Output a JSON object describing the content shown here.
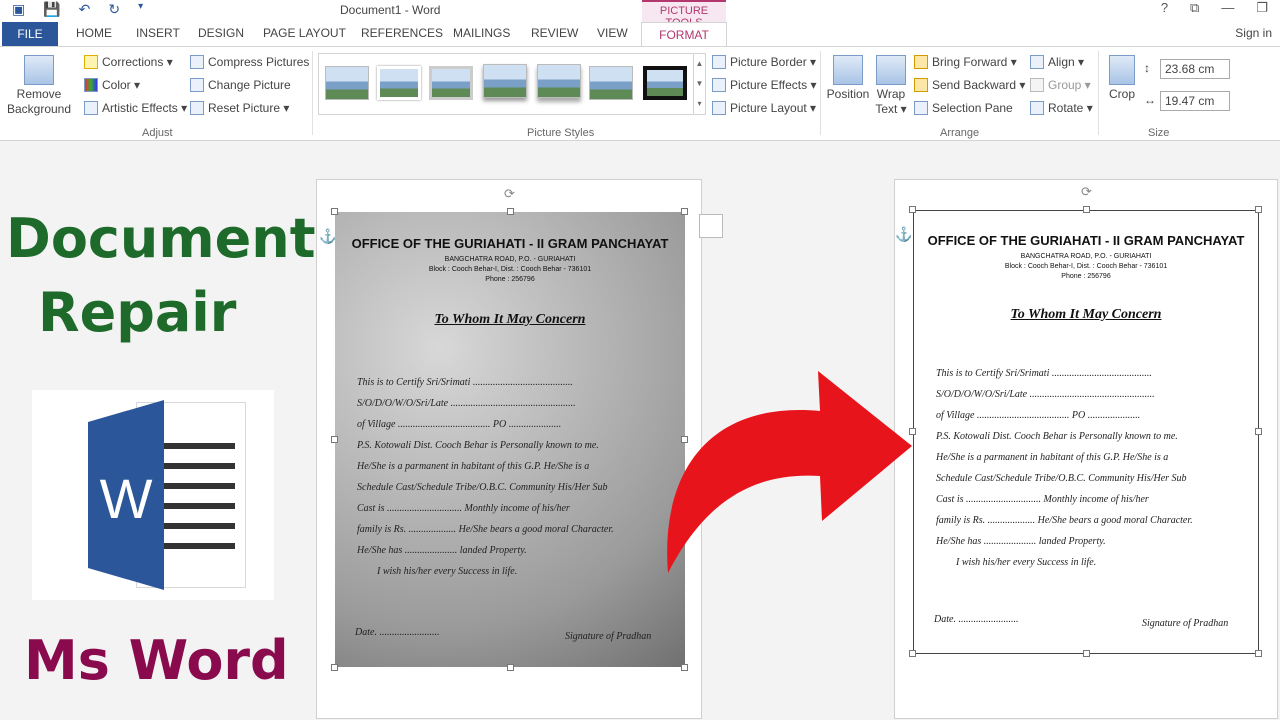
{
  "window": {
    "title": "Document1 - Word",
    "context_title": "PICTURE TOOLS",
    "controls": [
      "?",
      "⧉",
      "—",
      "❐"
    ]
  },
  "tabs": [
    "FILE",
    "HOME",
    "INSERT",
    "DESIGN",
    "PAGE LAYOUT",
    "REFERENCES",
    "MAILINGS",
    "REVIEW",
    "VIEW",
    "FORMAT"
  ],
  "signin": "Sign in",
  "ribbon": {
    "adjust": {
      "remove_bg": "Remove Background",
      "corrections": "Corrections ▾",
      "color": "Color ▾",
      "artistic": "Artistic Effects ▾",
      "compress": "Compress Pictures",
      "change": "Change Picture",
      "reset": "Reset Picture ▾",
      "label": "Adjust"
    },
    "styles": {
      "border": "Picture Border ▾",
      "effects": "Picture Effects ▾",
      "layout": "Picture Layout ▾",
      "label": "Picture Styles"
    },
    "arrange": {
      "position": "Position",
      "wrap": "Wrap Text ▾",
      "bring_forward": "Bring Forward ▾",
      "send_backward": "Send Backward ▾",
      "selection_pane": "Selection Pane",
      "align": "Align ▾",
      "group": "Group ▾",
      "rotate": "Rotate ▾",
      "label": "Arrange"
    },
    "size": {
      "crop": "Crop",
      "height": "23.68 cm",
      "width": "19.47 cm",
      "label": "Size"
    }
  },
  "overlay": {
    "line1": "Document",
    "line2": "Repair",
    "line3": "Ms Word",
    "color_green": "#1e6a2a",
    "color_maroon": "#8a0a4e",
    "arrow_color": "#e8141c"
  },
  "document": {
    "office": "OFFICE OF THE GURIAHATI - II GRAM PANCHAYAT",
    "address1": "BANGCHATRA ROAD, P.O. - GURIAHATI",
    "address2": "Block : Cooch Behar-I, Dist. : Cooch Behar - 736101",
    "phone": "Phone : 256796",
    "heading": "To Whom It May Concern",
    "lines": [
      "This is to Certify Sri/Srimati ........................................",
      "S/O/D/O/W/O/Sri/Late ..................................................",
      "of Village ..................................... PO .....................",
      "P.S. Kotowali Dist. Cooch Behar is Personally known to me.",
      "He/She is a parmanent in habitant of this G.P. He/She is a",
      "Schedule Cast/Schedule Tribe/O.B.C. Community His/Her Sub",
      "Cast is .............................. Monthly income of his/her",
      "family is Rs. ................... He/She bears a good moral Character.",
      "He/She has ..................... landed Property.",
      "I wish his/her every Success in life."
    ],
    "date": "Date. ........................",
    "signature": "Signature of Pradhan"
  }
}
